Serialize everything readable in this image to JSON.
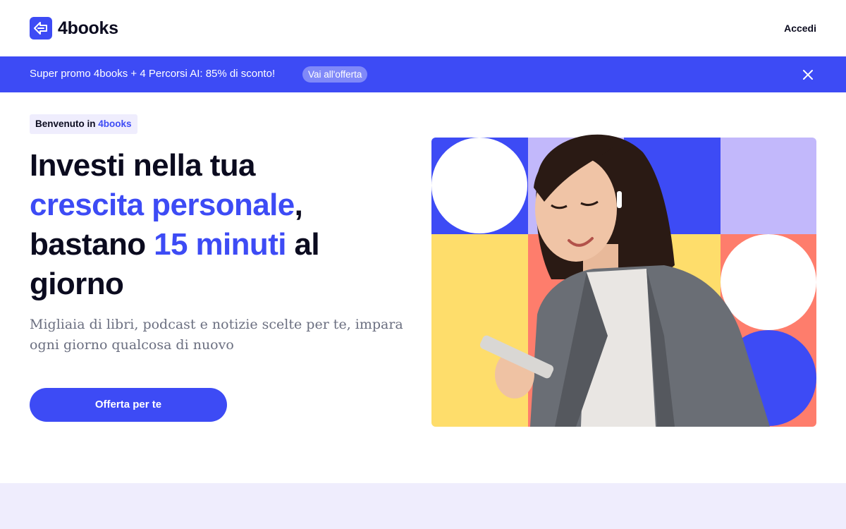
{
  "header": {
    "brand_name": "4books",
    "login_label": "Accedi"
  },
  "promo": {
    "text": "Super promo 4books + 4 Percorsi AI: 85% di sconto!",
    "cta_label": "Vai all'offerta"
  },
  "hero": {
    "badge_prefix": "Benvenuto in ",
    "badge_brand": "4books",
    "headline": {
      "line1": "Investi nella tua",
      "accent1": "crescita personale",
      "comma": ",",
      "part2": "bastano ",
      "accent2": "15 minuti",
      "part3": " al giorno"
    },
    "subtitle": "Migliaia di libri, podcast e notizie scelte per te, impara ogni giorno qualcosa di nuovo",
    "cta_label": "Offerta per te"
  },
  "colors": {
    "brand_blue": "#3d4bf5",
    "lavender": "#c2b8fb",
    "yellow": "#fedd6b",
    "coral": "#fe7d6c",
    "badge_bg": "#efedfd"
  },
  "icons": {
    "logo": "arrow-logo-icon",
    "close": "close-icon"
  }
}
